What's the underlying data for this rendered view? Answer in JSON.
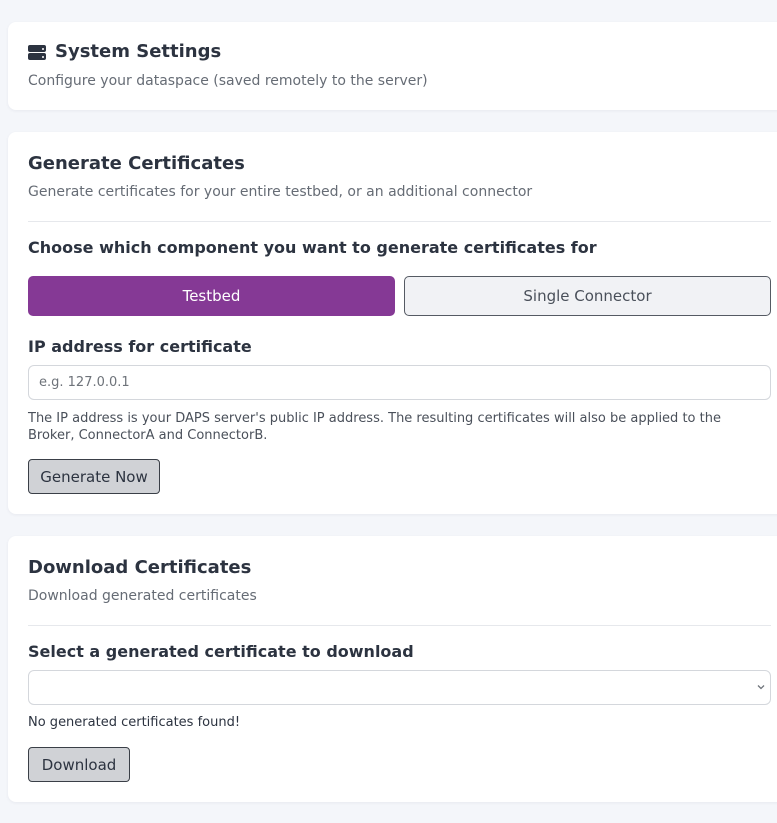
{
  "header": {
    "icon": "server-icon",
    "title": "System Settings",
    "subtitle": "Configure your dataspace (saved remotely to the server)"
  },
  "generate": {
    "title": "Generate Certificates",
    "subtitle": "Generate certificates for your entire testbed, or an additional connector",
    "component_label": "Choose which component you want to generate certificates for",
    "options": [
      {
        "label": "Testbed",
        "active": true
      },
      {
        "label": "Single Connector",
        "active": false
      }
    ],
    "ip_label": "IP address for certificate",
    "ip_value": "",
    "ip_placeholder": "e.g. 127.0.0.1",
    "ip_help": "The IP address is your DAPS server's public IP address. The resulting certificates will also be applied to the Broker, ConnectorA and ConnectorB.",
    "generate_button": "Generate Now"
  },
  "download": {
    "title": "Download Certificates",
    "subtitle": "Download generated certificates",
    "select_label": "Select a generated certificate to download",
    "selected_value": "",
    "empty_note": "No generated certificates found!",
    "download_button": "Download"
  },
  "colors": {
    "accent": "#853995",
    "background": "#f4f6fa",
    "card": "#ffffff",
    "text": "#2c3340"
  }
}
